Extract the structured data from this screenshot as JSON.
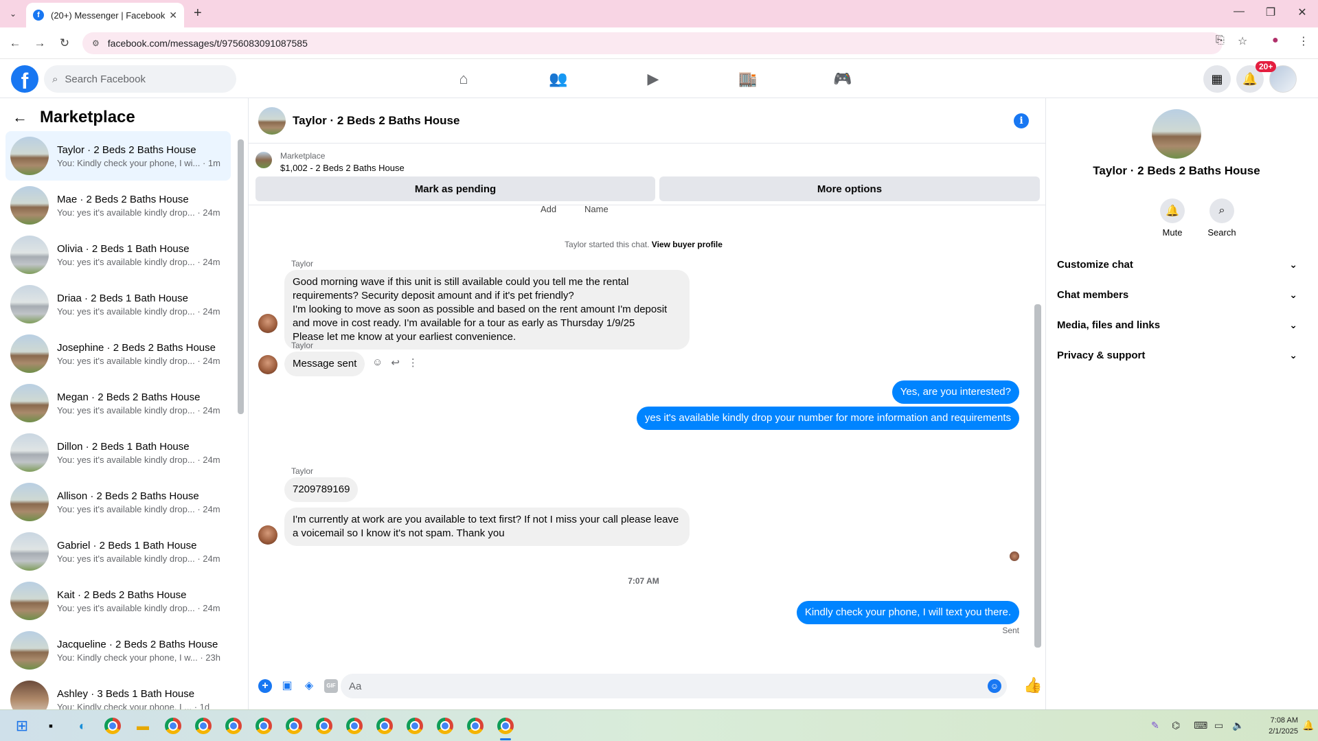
{
  "browser": {
    "tab_title": "(20+) Messenger | Facebook",
    "url": "facebook.com/messages/t/9756083091087585"
  },
  "header": {
    "search_placeholder": "Search Facebook",
    "notification_badge": "20+"
  },
  "sidebar": {
    "title": "Marketplace",
    "conversations": [
      {
        "name": "Taylor · 2 Beds 2 Baths House",
        "preview": "You: Kindly check your phone, I wi... · 1m",
        "active": true
      },
      {
        "name": "Mae · 2 Beds 2 Baths House",
        "preview": "You: yes it's available kindly drop... · 24m"
      },
      {
        "name": "Olivia · 2 Beds 1 Bath House",
        "preview": "You: yes it's available kindly drop... · 24m"
      },
      {
        "name": "Driaa · 2 Beds 1 Bath House",
        "preview": "You: yes it's available kindly drop... · 24m"
      },
      {
        "name": "Josephine · 2 Beds 2 Baths House",
        "preview": "You: yes it's available kindly drop... · 24m"
      },
      {
        "name": "Megan · 2 Beds 2 Baths House",
        "preview": "You: yes it's available kindly drop... · 24m"
      },
      {
        "name": "Dillon · 2 Beds 1 Bath House",
        "preview": "You: yes it's available kindly drop... · 24m"
      },
      {
        "name": "Allison · 2 Beds 2 Baths House",
        "preview": "You: yes it's available kindly drop... · 24m"
      },
      {
        "name": "Gabriel · 2 Beds 1 Bath House",
        "preview": "You: yes it's available kindly drop... · 24m"
      },
      {
        "name": "Kait · 2 Beds 2 Baths House",
        "preview": "You: yes it's available kindly drop... · 24m"
      },
      {
        "name": "Jacqueline · 2 Beds 2 Baths House",
        "preview": "You: Kindly check your phone, I w... · 23h"
      },
      {
        "name": "Ashley · 3 Beds 1 Bath House",
        "preview": "You: Kindly check your phone, I ... · 1d"
      }
    ]
  },
  "chat": {
    "title": "Taylor · 2 Beds 2 Baths House",
    "marketplace_label": "Marketplace",
    "listing": "$1,002 - 2 Beds 2 Baths House",
    "mark_pending": "Mark as pending",
    "more_options": "More options",
    "cut_labels": [
      "Add",
      "Name"
    ],
    "system_text": "Taylor started this chat.",
    "system_link": "View buyer profile",
    "sender_name": "Taylor",
    "msg1": "Good morning wave if this unit is still available could you tell me the rental requirements? Security deposit amount and if it's pet friendly?",
    "msg1b": "I'm looking to move as soon as possible and based on the rent amount I'm deposit and move in cost ready. I'm available for a tour as early as Thursday 1/9/25",
    "msg1c": "Please let me know at your earliest convenience.",
    "msg2": "Message sent",
    "out1": "Yes, are you interested?",
    "out2": "yes it's available kindly drop your number for more information and requirements",
    "msg3": "7209789169",
    "msg4": "I'm currently at work are you available to text first? If not I miss your call please leave a voicemail so I know it's not spam. Thank you",
    "time_divider": "7:07 AM",
    "out3": "Kindly check your phone, I will text you there.",
    "sent_status": "Sent",
    "composer_placeholder": "Aa"
  },
  "right_panel": {
    "name": "Taylor · 2 Beds 2 Baths House",
    "mute": "Mute",
    "search": "Search",
    "sections": [
      "Customize chat",
      "Chat members",
      "Media, files and links",
      "Privacy & support"
    ]
  },
  "taskbar": {
    "time": "7:08 AM",
    "date": "2/1/2025"
  }
}
